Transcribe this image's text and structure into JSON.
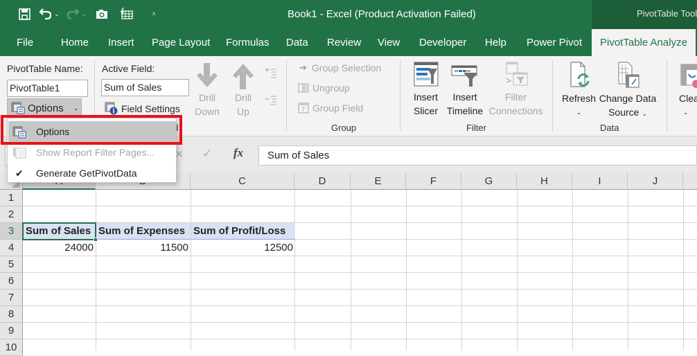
{
  "window": {
    "title": "Book1  -  Excel (Product Activation Failed)",
    "context_tab_group": "PivotTable Tools"
  },
  "quick_access": [
    "save-icon",
    "undo-icon",
    "redo-icon",
    "camera-icon",
    "quick-table-icon",
    "customize-qat-icon"
  ],
  "tabs": [
    {
      "label": "File"
    },
    {
      "label": "Home"
    },
    {
      "label": "Insert"
    },
    {
      "label": "Page Layout"
    },
    {
      "label": "Formulas"
    },
    {
      "label": "Data"
    },
    {
      "label": "Review"
    },
    {
      "label": "View"
    },
    {
      "label": "Developer"
    },
    {
      "label": "Help"
    },
    {
      "label": "Power Pivot"
    },
    {
      "label": "PivotTable Analyze",
      "active": true
    }
  ],
  "ribbon": {
    "pivottable_name_label": "PivotTable Name:",
    "pivottable_name_value": "PivotTable1",
    "options_button": "Options",
    "active_field_label": "Active Field:",
    "active_field_value": "Sum of Sales",
    "field_settings": "Field Settings",
    "active_field_group": "Active Field",
    "drill_down": [
      "Drill",
      "Down"
    ],
    "drill_up": [
      "Drill",
      "Up"
    ],
    "group_selection": "Group Selection",
    "ungroup": "Ungroup",
    "group_field": "Group Field",
    "group_group": "Group",
    "insert_slicer": [
      "Insert",
      "Slicer"
    ],
    "insert_timeline": [
      "Insert",
      "Timeline"
    ],
    "filter_connections": [
      "Filter",
      "Connections"
    ],
    "filter_group": "Filter",
    "refresh": "Refresh",
    "change_data_source": [
      "Change Data",
      "Source"
    ],
    "data_group": "Data",
    "clear": "Clea"
  },
  "options_menu": {
    "items": [
      {
        "label": "Options",
        "highlighted": true,
        "enabled": true
      },
      {
        "label": "Show Report Filter Pages...",
        "enabled": false
      },
      {
        "label": "Generate GetPivotData",
        "checked": true,
        "enabled": true
      }
    ]
  },
  "formula_bar": {
    "fx": "fx",
    "content": "Sum of Sales"
  },
  "sheet": {
    "columns": [
      "A",
      "B",
      "C",
      "D",
      "E",
      "F",
      "G",
      "H",
      "I",
      "J"
    ],
    "rows": [
      "1",
      "2",
      "3",
      "4",
      "5",
      "6",
      "7",
      "8",
      "9",
      "10"
    ],
    "pivot_headers": [
      "Sum of Sales",
      "Sum of Expenses",
      "Sum of Profit/Loss"
    ],
    "pivot_values": [
      "24000",
      "11500",
      "12500"
    ],
    "selected_cell": "A3"
  },
  "colors": {
    "excel_green": "#217346",
    "context_green": "#1b5e37",
    "pivot_header_fill": "#d9e1f2",
    "highlight_red": "#e8111b"
  }
}
